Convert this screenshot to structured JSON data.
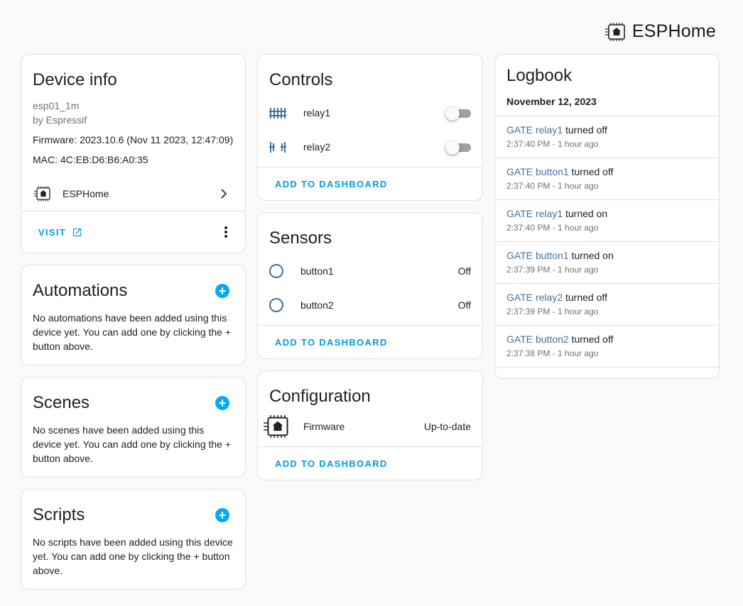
{
  "brand": {
    "name": "ESPHome",
    "icon": "esphome-chip-icon"
  },
  "device_info": {
    "title": "Device info",
    "model": "esp01_1m",
    "manufacturer": "by Espressif",
    "firmware": "Firmware: 2023.10.6 (Nov 11 2023, 12:47:09)",
    "mac": "MAC: 4C:EB:D6:B6:A0:35",
    "integration": "ESPHome",
    "visit_label": "Visit"
  },
  "automations": {
    "title": "Automations",
    "text": "No automations have been added using this device yet. You can add one by clicking the + button above."
  },
  "scenes": {
    "title": "Scenes",
    "text": "No scenes have been added using this device yet. You can add one by clicking the + button above."
  },
  "scripts": {
    "title": "Scripts",
    "text": "No scripts have been added using this device yet. You can add one by clicking the + button above."
  },
  "controls": {
    "title": "Controls",
    "items": [
      {
        "name": "relay1",
        "icon": "gate-icon",
        "state": "off"
      },
      {
        "name": "relay2",
        "icon": "gate-open-icon",
        "state": "off"
      }
    ],
    "add_label": "Add to dashboard"
  },
  "sensors": {
    "title": "Sensors",
    "items": [
      {
        "name": "button1",
        "state": "Off",
        "icon": "radiobox-icon"
      },
      {
        "name": "button2",
        "state": "Off",
        "icon": "radiobox-icon"
      }
    ],
    "add_label": "Add to dashboard"
  },
  "configuration": {
    "title": "Configuration",
    "items": [
      {
        "name": "Firmware",
        "state": "Up-to-date",
        "icon": "esphome-chip-icon"
      }
    ],
    "add_label": "Add to dashboard"
  },
  "logbook": {
    "title": "Logbook",
    "date": "November 12, 2023",
    "entries": [
      {
        "entity": "GATE relay1",
        "action": "turned off",
        "time": "2:37:40 PM - 1 hour ago"
      },
      {
        "entity": "GATE button1",
        "action": "turned off",
        "time": "2:37:40 PM - 1 hour ago"
      },
      {
        "entity": "GATE relay1",
        "action": "turned on",
        "time": "2:37:40 PM - 1 hour ago"
      },
      {
        "entity": "GATE button1",
        "action": "turned on",
        "time": "2:37:39 PM - 1 hour ago"
      },
      {
        "entity": "GATE relay2",
        "action": "turned off",
        "time": "2:37:39 PM - 1 hour ago"
      },
      {
        "entity": "GATE button2",
        "action": "turned off",
        "time": "2:37:38 PM - 1 hour ago"
      }
    ]
  },
  "colors": {
    "accent": "#03a9f4",
    "link": "#44739e",
    "button_text": "#039be5"
  }
}
